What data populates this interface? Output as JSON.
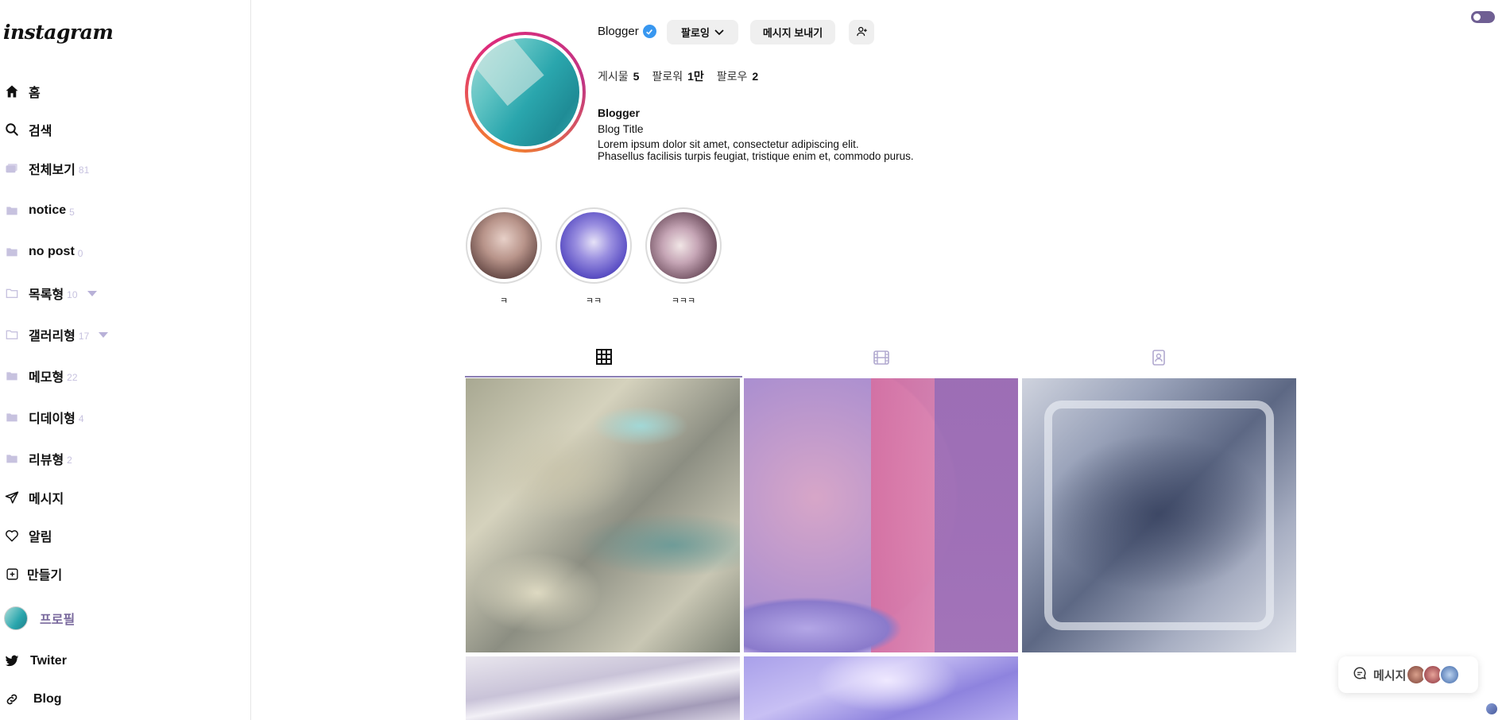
{
  "logo": "instagram",
  "sidebar": {
    "items": [
      {
        "label": "홈",
        "icon": "home-icon"
      },
      {
        "label": "검색",
        "icon": "search-icon"
      },
      {
        "label": "전체보기",
        "count": "81",
        "icon": "stack-icon"
      },
      {
        "label": "notice",
        "count": "5",
        "icon": "folder-icon"
      },
      {
        "label": "no post",
        "count": "0",
        "icon": "folder-icon"
      },
      {
        "label": "목록형",
        "count": "10",
        "icon": "folder-outline-icon"
      },
      {
        "label": "갤러리형",
        "count": "17",
        "icon": "folder-outline-icon"
      },
      {
        "label": "메모형",
        "count": "22",
        "icon": "folder-icon"
      },
      {
        "label": "디데이형",
        "count": "4",
        "icon": "folder-icon"
      },
      {
        "label": "리뷰형",
        "count": "2",
        "icon": "folder-icon"
      },
      {
        "label": "메시지",
        "icon": "send-icon"
      },
      {
        "label": "알림",
        "icon": "heart-icon"
      },
      {
        "label": "만들기",
        "icon": "plus-square-icon"
      },
      {
        "label": "프로필",
        "icon": "avatar"
      },
      {
        "label": "Twiter",
        "icon": "twitter-icon"
      },
      {
        "label": "Blog",
        "icon": "link-icon"
      }
    ]
  },
  "profile": {
    "username": "Blogger",
    "follow_label": "팔로잉",
    "message_label": "메시지 보내기",
    "stats": [
      {
        "label": "게시물",
        "value": "5"
      },
      {
        "label": "팔로워",
        "value": "1만"
      },
      {
        "label": "팔로우",
        "value": "2"
      }
    ],
    "bio_name": "Blogger",
    "bio_title": "Blog Title",
    "bio_line1": "Lorem ipsum dolor sit amet, consectetur adipiscing elit.",
    "bio_line2": "Phasellus facilisis turpis feugiat, tristique enim et, commodo purus."
  },
  "highlights": [
    {
      "label": "ㅋ"
    },
    {
      "label": "ㅋㅋ"
    },
    {
      "label": "ㅋㅋㅋ"
    }
  ],
  "tabs": [
    {
      "icon": "grid-icon",
      "active": true
    },
    {
      "icon": "reels-icon",
      "active": false
    },
    {
      "icon": "tagged-icon",
      "active": false
    }
  ],
  "chat": {
    "label": "메시지"
  },
  "colors": {
    "accent": "#6f5f93",
    "folder": "#c7c2df",
    "verified": "#3897f0"
  }
}
